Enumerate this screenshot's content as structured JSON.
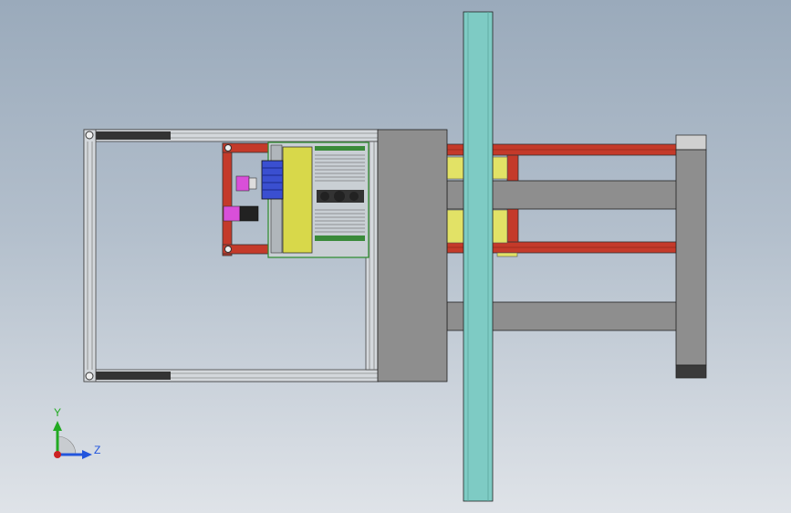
{
  "viewport": {
    "title": "",
    "colors": {
      "background_top": "#9aaabb",
      "background_bottom": "#dfe3e8",
      "frame_aluminum": "#c8ccd0",
      "red_beam": "#c43a2a",
      "gray_block": "#8e8e8e",
      "teal_column": "#7ecbc4",
      "yellow_panel": "#d8d84a",
      "blue_motor": "#3a4fd0",
      "magenta_part": "#d94fd9"
    }
  },
  "triad": {
    "y_label": "Y",
    "z_label": "Z",
    "y_color": "#22aa22",
    "z_color": "#2255dd",
    "origin_color": "#cc2222"
  }
}
